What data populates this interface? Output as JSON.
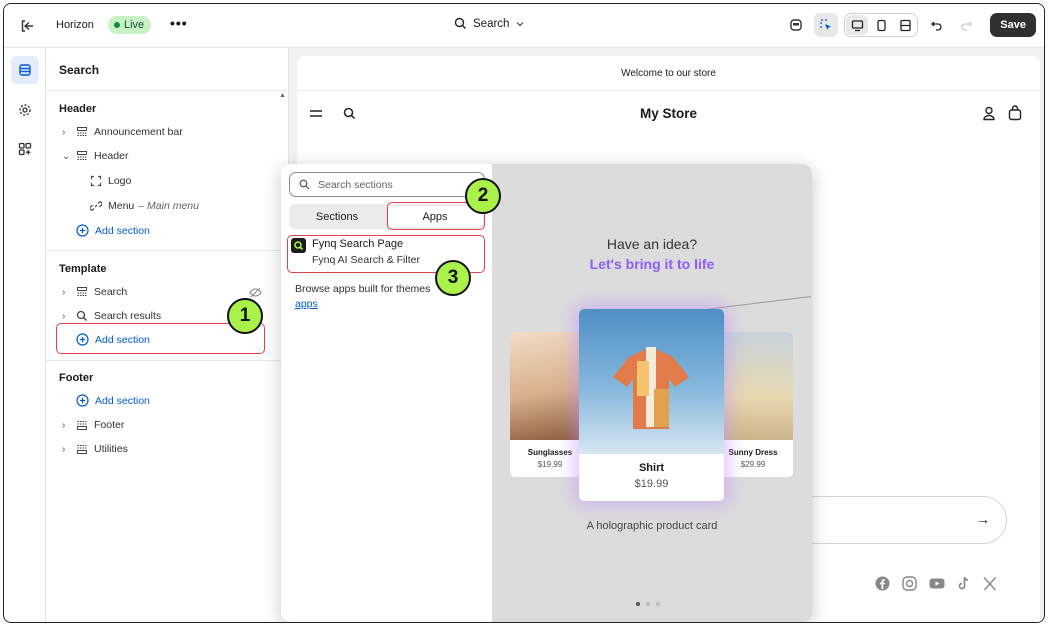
{
  "topbar": {
    "theme_name": "Horizon",
    "live_badge": "Live",
    "more": "•••",
    "page_selector": "Search",
    "save_label": "Save"
  },
  "sidebar": {
    "title": "Search",
    "header_group": "Header",
    "header_items": {
      "announcement_bar": "Announcement bar",
      "header": "Header",
      "logo": "Logo",
      "menu": "Menu",
      "menu_meta": "– Main menu",
      "add_section": "Add section"
    },
    "template_group": "Template",
    "template_items": {
      "search": "Search",
      "search_results": "Search results",
      "add_section": "Add section"
    },
    "footer_group": "Footer",
    "footer_items": {
      "add_section": "Add section",
      "footer": "Footer",
      "utilities": "Utilities"
    }
  },
  "preview": {
    "announcement": "Welcome to our store",
    "store_name": "My Store"
  },
  "popup": {
    "search_placeholder": "Search sections",
    "tabs": [
      "Sections",
      "Apps"
    ],
    "selected_tab": "Apps",
    "app_name": "Fynq Search Page",
    "app_subtitle": "Fynq AI Search & Filter",
    "browse_text": "Browse apps built for themes",
    "browse_link": "apps",
    "promo_title": "Have an idea?",
    "promo_subtitle": "Let's bring it to life",
    "cards": [
      {
        "name": "Sunglasses",
        "price": "$19.99"
      },
      {
        "name": "Shirt",
        "price": "$19.99"
      },
      {
        "name": "Sunny Dress",
        "price": "$29.99"
      }
    ],
    "caption": "A holographic product card"
  },
  "annotations": {
    "badge1": "1",
    "badge2": "2",
    "badge3": "3"
  },
  "colors": {
    "accent": "#005bd3",
    "highlight": "#e0424b",
    "badge": "#aaf24a",
    "promo": "#8b5cf6",
    "save": "#303030"
  }
}
